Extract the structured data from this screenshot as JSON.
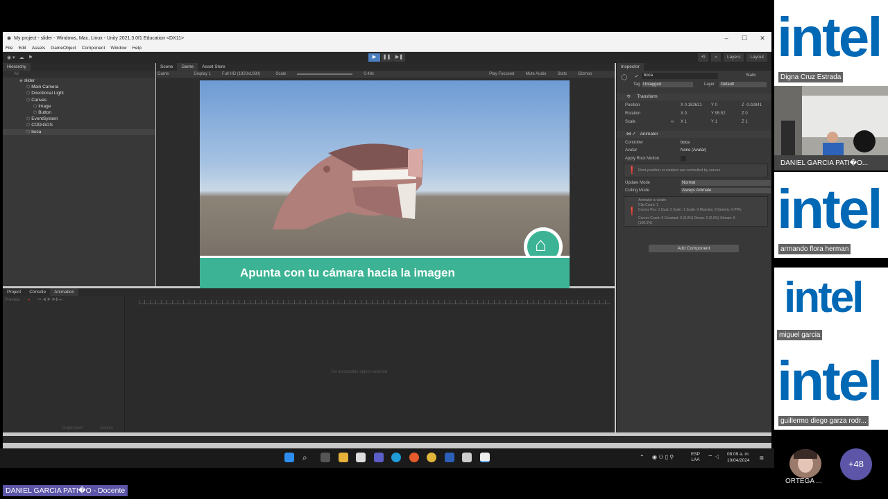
{
  "window": {
    "title": "My project - slider - Windows, Mac, Linux - Unity 2021.3.0f1 Education <DX11>",
    "menu": [
      "File",
      "Edit",
      "Assets",
      "GameObject",
      "Component",
      "Window",
      "Help"
    ]
  },
  "toolbar": {
    "layers": "Layers",
    "layout": "Layout"
  },
  "hierarchy": {
    "tab": "Hierarchy",
    "search": "All",
    "items": [
      {
        "label": "slider"
      },
      {
        "label": "Main Camera"
      },
      {
        "label": "Directional Light"
      },
      {
        "label": "Canvas"
      },
      {
        "label": "Image"
      },
      {
        "label": "Button"
      },
      {
        "label": "EventSystem"
      },
      {
        "label": "CODIGOS"
      },
      {
        "label": "boca"
      }
    ]
  },
  "game": {
    "tabs": [
      "Scene",
      "Game",
      "Asset Store"
    ],
    "mode": "Game",
    "display": "Display 1",
    "resolution": "Full HD (1920x1080)",
    "scale_label": "Scale",
    "scale_value": "0.48x",
    "play_focused": "Play Focused",
    "mute": "Mute Audio",
    "stats": "Stats",
    "gizmos": "Gizmos",
    "banner": "Apunta con tu cámara hacia la imagen"
  },
  "inspector": {
    "tab": "Inspector",
    "object_name": "boca",
    "static": "Static",
    "tag_label": "Tag",
    "tag": "Untagged",
    "layer_label": "Layer",
    "layer": "Default",
    "transform": {
      "title": "Transform",
      "position_label": "Position",
      "position": {
        "x": "0.182621",
        "y": "0",
        "z": "-0.02841"
      },
      "rotation_label": "Rotation",
      "rotation": {
        "x": "0",
        "y": "95.52",
        "z": "0"
      },
      "scale_label": "Scale",
      "scale": {
        "x": "1",
        "y": "1",
        "z": "1"
      }
    },
    "animator": {
      "title": "Animator",
      "controller_label": "Controller",
      "controller": "boca",
      "avatar_label": "Avatar",
      "avatar": "None (Avatar)",
      "root_motion_label": "Apply Root Motion",
      "root_info": "Root position or rotation are controlled by curves",
      "update_mode_label": "Update Mode",
      "update_mode": "Normal",
      "culling_label": "Culling Mode",
      "culling": "Always Animate",
      "clip_info_1": "Animator is visible",
      "clip_info_2": "Clip Count: 1",
      "clip_info_3": "Curves Pos: 1 Quat: 0 Euler: 1 Scale: 0 Muscles: 0 Generic: 0 PPtr:",
      "clip_info_4": "Curves Count: 6 Constant: 0 (0.0%) Dense: 0 (0.0%) Stream: 6",
      "clip_info_5": "(100.0%)"
    },
    "add_component": "Add Component"
  },
  "bottom": {
    "tabs": [
      "Project",
      "Console",
      "Animation"
    ],
    "preview": "Preview",
    "empty_msg": "No animatable object selected",
    "dopesheet": "Dopesheet",
    "curves": "Curves"
  },
  "taskbar": {
    "lang1": "ESP",
    "lang2": "LAA",
    "time": "08:09 a. m.",
    "date": "10/04/2024"
  },
  "participants": [
    {
      "name": "Digna Cruz Estrada"
    },
    {
      "name": "DANIEL GARCIA PATI�O..."
    },
    {
      "name": "armando flora herman"
    },
    {
      "name": "miguel garcia"
    },
    {
      "name": "guillermo diego garza rodr..."
    }
  ],
  "logo_text": "intel",
  "more_count": "+48",
  "self_name": "ORTEGA ...",
  "caption": "DANIEL GARCIA PATI�O - Docente"
}
